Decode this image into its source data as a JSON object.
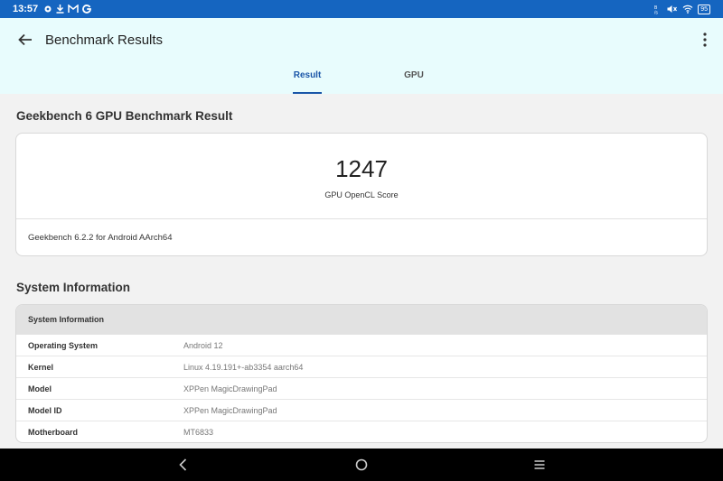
{
  "status_bar": {
    "time": "13:57",
    "left_icons": [
      "gear-icon",
      "download-icon",
      "mail-icon",
      "g-icon"
    ],
    "right_icons": [
      "data-speed-icon",
      "mute-icon",
      "wifi-icon"
    ],
    "battery": "95"
  },
  "app_bar": {
    "title": "Benchmark Results",
    "tabs": [
      {
        "label": "Result",
        "active": true
      },
      {
        "label": "GPU",
        "active": false
      }
    ],
    "accent_color": "#1a56a8"
  },
  "result": {
    "heading": "Geekbench 6 GPU Benchmark Result",
    "score": "1247",
    "score_label": "GPU OpenCL Score",
    "version": "Geekbench 6.2.2 for Android AArch64"
  },
  "system_info": {
    "heading": "System Information",
    "table_header": "System Information",
    "rows": [
      {
        "key": "Operating System",
        "value": "Android 12"
      },
      {
        "key": "Kernel",
        "value": "Linux 4.19.191+-ab3354 aarch64"
      },
      {
        "key": "Model",
        "value": "XPPen MagicDrawingPad"
      },
      {
        "key": "Model ID",
        "value": "XPPen MagicDrawingPad"
      },
      {
        "key": "Motherboard",
        "value": "MT6833"
      }
    ]
  },
  "nav_bar": {
    "buttons": [
      "back-icon",
      "home-icon",
      "menu-icon"
    ]
  }
}
